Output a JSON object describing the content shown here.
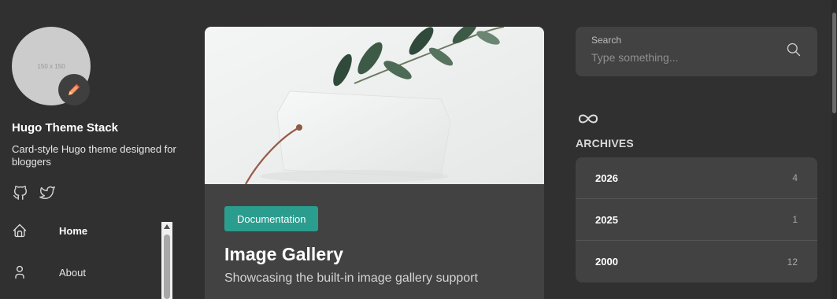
{
  "sidebar": {
    "avatar_placeholder": "150 x 150",
    "avatar_badge_icon": "pencil-icon",
    "site_name": "Hugo Theme Stack",
    "site_description": "Card-style Hugo theme designed for bloggers",
    "social": [
      {
        "icon": "github-icon"
      },
      {
        "icon": "twitter-icon"
      }
    ],
    "menu": [
      {
        "label": "Home",
        "icon": "home-icon",
        "active": true
      },
      {
        "label": "About",
        "icon": "user-icon",
        "active": false
      }
    ]
  },
  "article": {
    "category": "Documentation",
    "title": "Image Gallery",
    "subtitle": "Showcasing the built-in image gallery support"
  },
  "search": {
    "label": "Search",
    "placeholder": "Type something...",
    "icon": "search-icon"
  },
  "archives": {
    "icon": "infinity-icon",
    "title": "ARCHIVES",
    "years": [
      {
        "year": "2026",
        "count": "4"
      },
      {
        "year": "2025",
        "count": "1"
      },
      {
        "year": "2000",
        "count": "12"
      }
    ]
  },
  "colors": {
    "background": "#303030",
    "card": "#424242",
    "accent": "#2a9d8f"
  }
}
